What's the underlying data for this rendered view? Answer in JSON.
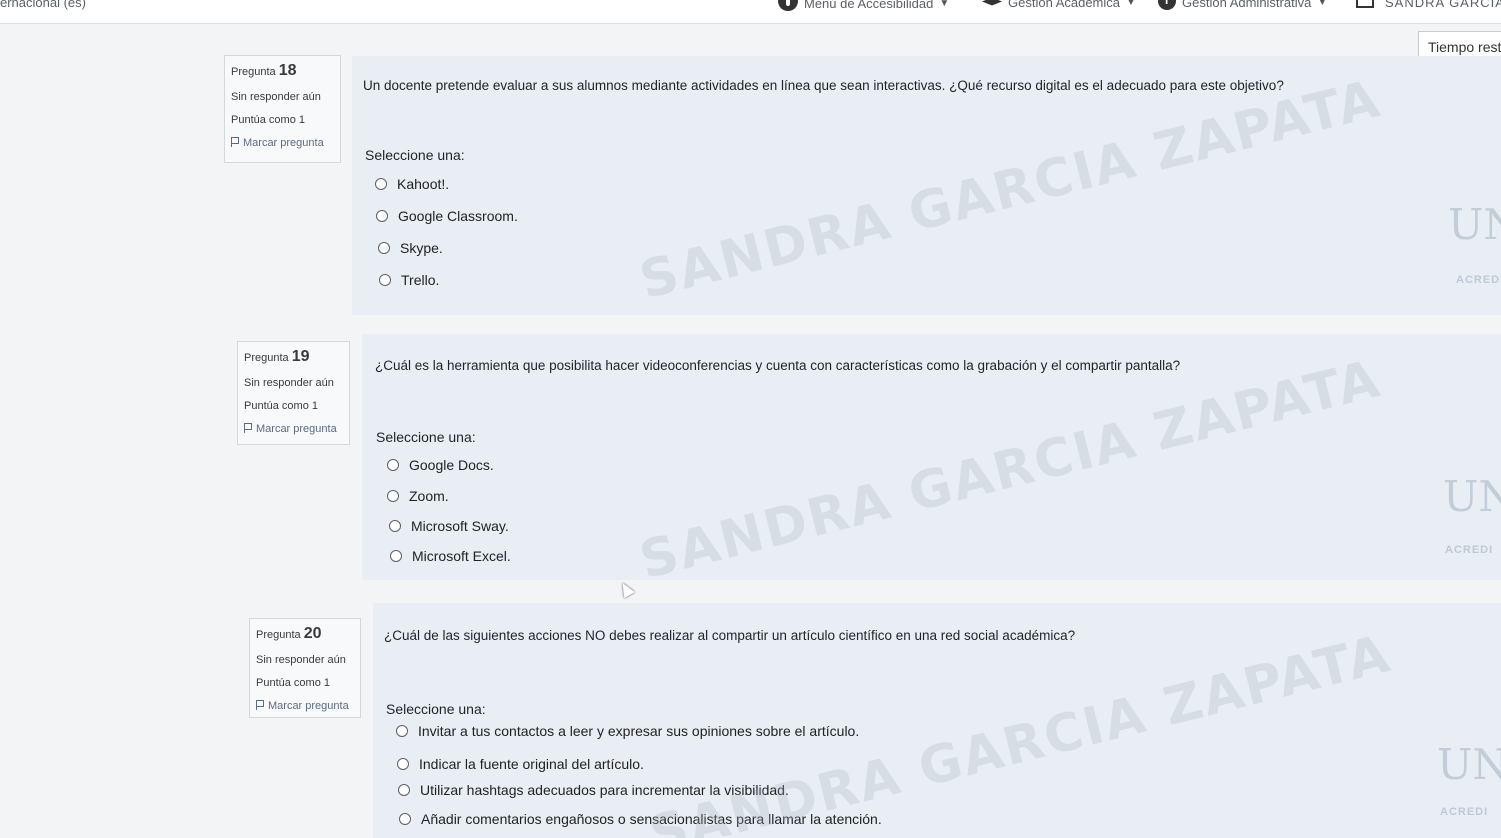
{
  "topbar": {
    "language": "ernacional (es)",
    "accessibility_menu": "Menú de Accesibilidad",
    "academic_menu": "Gestión Académica",
    "admin_menu": "Gestión Administrativa",
    "user_name": "SANDRA GARCIA Z"
  },
  "timer": {
    "label": "Tiempo rest"
  },
  "watermark": {
    "text": "SANDRA GARCIA ZAPATA"
  },
  "logo": {
    "initials": "UN",
    "badge": "ACREDI"
  },
  "questions": [
    {
      "label": "Pregunta",
      "number": "18",
      "status": "Sin responder aún",
      "points": "Puntúa como 1",
      "flag": "Marcar pregunta",
      "text": "Un docente pretende evaluar a sus alumnos mediante actividades en línea que sean interactivas. ¿Qué recurso digital es el adecuado para este objetivo?",
      "prompt": "Seleccione una:",
      "options": [
        "Kahoot!.",
        "Google Classroom.",
        "Skype.",
        "Trello."
      ]
    },
    {
      "label": "Pregunta",
      "number": "19",
      "status": "Sin responder aún",
      "points": "Puntúa como 1",
      "flag": "Marcar pregunta",
      "text": "¿Cuál es la herramienta que posibilita hacer videoconferencias y cuenta con características como la grabación y el compartir pantalla?",
      "prompt": "Seleccione una:",
      "options": [
        "Google Docs.",
        "Zoom.",
        "Microsoft Sway.",
        "Microsoft Excel."
      ]
    },
    {
      "label": "Pregunta",
      "number": "20",
      "status": "Sin responder aún",
      "points": "Puntúa como 1",
      "flag": "Marcar pregunta",
      "text": "¿Cuál de las siguientes acciones NO debes realizar al compartir un artículo científico en una red social académica?",
      "prompt": "Seleccione una:",
      "options": [
        "Invitar a tus contactos a leer y expresar sus opiniones sobre el artículo.",
        "Indicar la fuente original del artículo.",
        "Utilizar hashtags adecuados para incrementar la visibilidad.",
        "Añadir comentarios engañosos o sensacionalistas para llamar la atención."
      ]
    }
  ]
}
